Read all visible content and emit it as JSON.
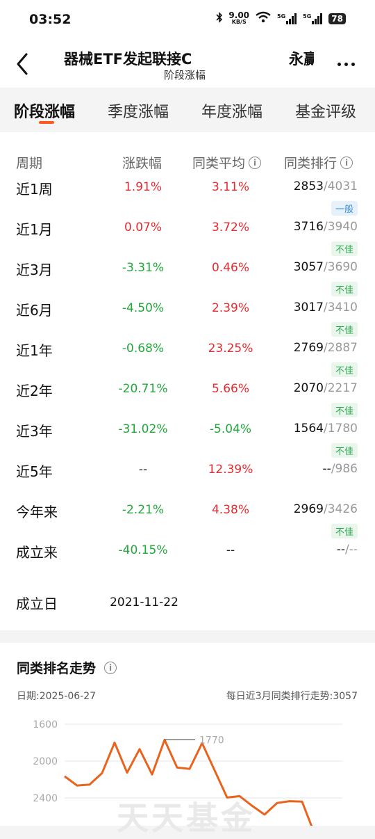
{
  "status_bar": {
    "time": "03:52",
    "net_speed": "9.00",
    "net_unit": "KB/S",
    "signal1": "5G",
    "signal2": "5G",
    "battery": "78"
  },
  "header": {
    "title": "器械ETF发起联接C",
    "subtitle": "阶段涨幅",
    "company": "永赢",
    "back_icon": "chevron-left-icon",
    "more_icon": "more-dots-icon"
  },
  "tabs": [
    {
      "label": "阶段涨幅",
      "active": true
    },
    {
      "label": "季度涨幅",
      "active": false
    },
    {
      "label": "年度涨幅",
      "active": false
    },
    {
      "label": "基金评级",
      "active": false
    }
  ],
  "table": {
    "headers": {
      "period": "周期",
      "change": "涨跌幅",
      "peer_avg": "同类平均",
      "peer_rank": "同类排行"
    },
    "rows": [
      {
        "period": "近1周",
        "change": "1.91%",
        "change_dir": "up",
        "avg": "3.11%",
        "avg_dir": "up",
        "rank": "2853",
        "total": "/4031",
        "badge": "一般",
        "badge_type": "normal"
      },
      {
        "period": "近1月",
        "change": "0.07%",
        "change_dir": "up",
        "avg": "3.72%",
        "avg_dir": "up",
        "rank": "3716",
        "total": "/3940",
        "badge": "不佳",
        "badge_type": "poor"
      },
      {
        "period": "近3月",
        "change": "-3.31%",
        "change_dir": "down",
        "avg": "0.46%",
        "avg_dir": "up",
        "rank": "3057",
        "total": "/3690",
        "badge": "不佳",
        "badge_type": "poor"
      },
      {
        "period": "近6月",
        "change": "-4.50%",
        "change_dir": "down",
        "avg": "2.39%",
        "avg_dir": "up",
        "rank": "3017",
        "total": "/3410",
        "badge": "不佳",
        "badge_type": "poor"
      },
      {
        "period": "近1年",
        "change": "-0.68%",
        "change_dir": "down",
        "avg": "23.25%",
        "avg_dir": "up",
        "rank": "2769",
        "total": "/2887",
        "badge": "不佳",
        "badge_type": "poor"
      },
      {
        "period": "近2年",
        "change": "-20.71%",
        "change_dir": "down",
        "avg": "5.66%",
        "avg_dir": "up",
        "rank": "2070",
        "total": "/2217",
        "badge": "不佳",
        "badge_type": "poor"
      },
      {
        "period": "近3年",
        "change": "-31.02%",
        "change_dir": "down",
        "avg": "-5.04%",
        "avg_dir": "down",
        "rank": "1564",
        "total": "/1780",
        "badge": "不佳",
        "badge_type": "poor"
      },
      {
        "period": "近5年",
        "change": "--",
        "change_dir": "none",
        "avg": "12.39%",
        "avg_dir": "up",
        "rank": "--",
        "total": "/986",
        "badge": "",
        "badge_type": ""
      },
      {
        "period": "今年来",
        "change": "-2.21%",
        "change_dir": "down",
        "avg": "4.38%",
        "avg_dir": "up",
        "rank": "2969",
        "total": "/3426",
        "badge": "不佳",
        "badge_type": "poor"
      },
      {
        "period": "成立来",
        "change": "-40.15%",
        "change_dir": "down",
        "avg": "--",
        "avg_dir": "none",
        "rank": "--",
        "total": "/--",
        "badge": "",
        "badge_type": ""
      }
    ],
    "inception_label": "成立日",
    "inception_date": "2021-11-22"
  },
  "rank_trend": {
    "title": "同类排名走势",
    "date_text": "日期:2025-06-27",
    "trend_text": "每日近3月同类排行走势:3057",
    "watermark": "天天基金"
  },
  "chart_data": {
    "type": "line",
    "yticks": [
      1600,
      2000,
      2400
    ],
    "y_inverted": true,
    "annotation": "1770",
    "series": [
      {
        "color": "#e8641e",
        "values": [
          2165,
          2265,
          2255,
          2130,
          1800,
          2125,
          1870,
          2145,
          1770,
          2070,
          2085,
          1805,
          2100,
          2395,
          2380,
          2485,
          2580,
          2455,
          2435,
          2440,
          2790
        ]
      }
    ],
    "colors": {
      "line": "#e8641e",
      "grid": "#e5e5e5"
    }
  }
}
